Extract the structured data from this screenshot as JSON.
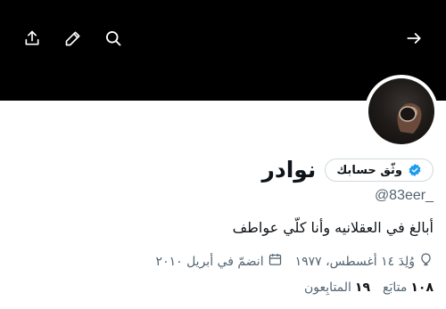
{
  "header": {
    "icons": {
      "back": "arrow-right-icon",
      "search": "search-icon",
      "edit": "pencil-icon",
      "share": "share-icon"
    }
  },
  "profile": {
    "display_name": "نوادر",
    "verify_button_label": "وثّق حسابك",
    "handle": "@83eer_",
    "bio": "أبالغ في العقلانيه وأنا كلّي عواطف",
    "birth": "وُلِدَ ١٤ أغسطس، ١٩٧٧",
    "joined": "انضمّ في أبريل ٢٠١٠",
    "following_count": "١٠٨",
    "following_label": "متابَع",
    "followers_count": "١٩",
    "followers_label": "المتابِعون"
  },
  "colors": {
    "banner": "#000000",
    "text_primary": "#0f1419",
    "text_secondary": "#536471",
    "verified_blue": "#1d9bf0",
    "border": "#cfd9de"
  }
}
